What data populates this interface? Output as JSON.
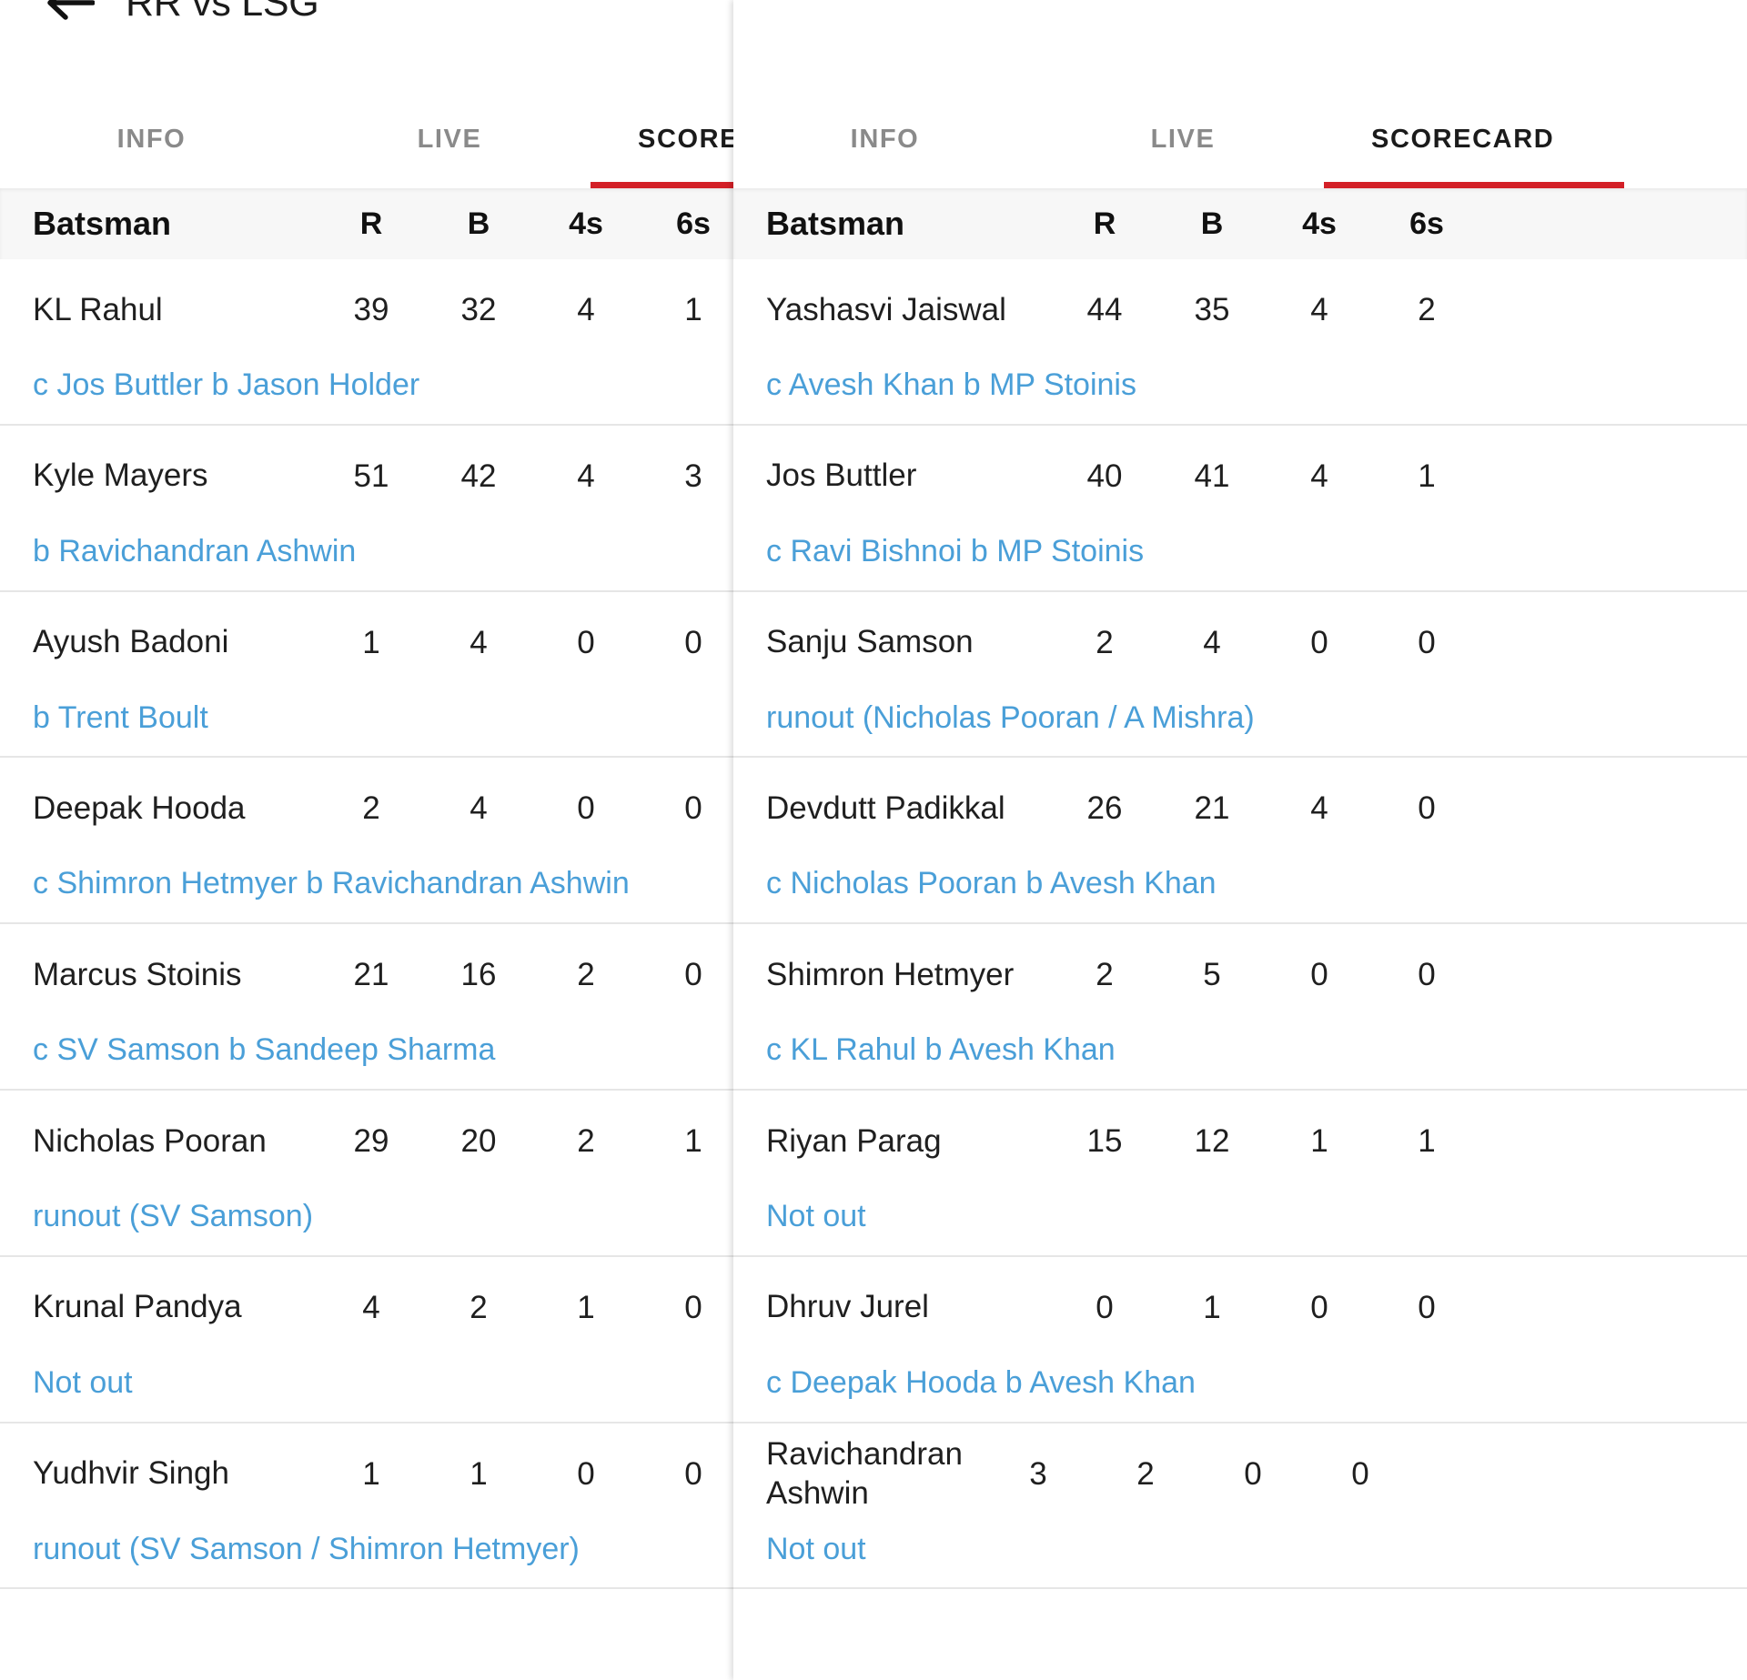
{
  "app": {
    "back_icon": "back-arrow-icon",
    "accent_red": "#d32027",
    "link_blue": "#4a9fd8"
  },
  "left_panel": {
    "title": "RR vs LSG",
    "tabs": [
      {
        "label": "INFO",
        "active": false
      },
      {
        "label": "LIVE",
        "active": false
      },
      {
        "label": "SCORECARD",
        "active": true
      }
    ],
    "table": {
      "headers": {
        "batsman": "Batsman",
        "runs": "R",
        "balls": "B",
        "fours": "4s",
        "sixes": "6s"
      },
      "rows": [
        {
          "name": "KL Rahul",
          "R": "39",
          "B": "32",
          "4s": "4",
          "6s": "1",
          "dismissal": "c Jos Buttler b Jason Holder"
        },
        {
          "name": "Kyle Mayers",
          "R": "51",
          "B": "42",
          "4s": "4",
          "6s": "3",
          "dismissal": "b Ravichandran Ashwin"
        },
        {
          "name": "Ayush Badoni",
          "R": "1",
          "B": "4",
          "4s": "0",
          "6s": "0",
          "dismissal": "b Trent Boult"
        },
        {
          "name": "Deepak Hooda",
          "R": "2",
          "B": "4",
          "4s": "0",
          "6s": "0",
          "dismissal": "c Shimron Hetmyer b Ravichandran Ashwin"
        },
        {
          "name": "Marcus Stoinis",
          "R": "21",
          "B": "16",
          "4s": "2",
          "6s": "0",
          "dismissal": "c SV Samson b Sandeep Sharma"
        },
        {
          "name": "Nicholas Pooran",
          "R": "29",
          "B": "20",
          "4s": "2",
          "6s": "1",
          "dismissal": "runout (SV Samson)"
        },
        {
          "name": "Krunal Pandya",
          "R": "4",
          "B": "2",
          "4s": "1",
          "6s": "0",
          "dismissal": "Not out"
        },
        {
          "name": "Yudhvir Singh",
          "R": "1",
          "B": "1",
          "4s": "0",
          "6s": "0",
          "dismissal": "runout (SV Samson / Shimron Hetmyer)"
        }
      ]
    }
  },
  "right_panel": {
    "tabs": [
      {
        "label": "INFO",
        "active": false
      },
      {
        "label": "LIVE",
        "active": false
      },
      {
        "label": "SCORECARD",
        "active": true
      }
    ],
    "table": {
      "headers": {
        "batsman": "Batsman",
        "runs": "R",
        "balls": "B",
        "fours": "4s",
        "sixes": "6s"
      },
      "rows": [
        {
          "name": "Yashasvi Jaiswal",
          "R": "44",
          "B": "35",
          "4s": "4",
          "6s": "2",
          "dismissal": "c Avesh Khan b MP Stoinis"
        },
        {
          "name": "Jos Buttler",
          "R": "40",
          "B": "41",
          "4s": "4",
          "6s": "1",
          "dismissal": "c Ravi Bishnoi b MP Stoinis"
        },
        {
          "name": "Sanju Samson",
          "R": "2",
          "B": "4",
          "4s": "0",
          "6s": "0",
          "dismissal": "runout (Nicholas Pooran / A Mishra)"
        },
        {
          "name": "Devdutt Padikkal",
          "R": "26",
          "B": "21",
          "4s": "4",
          "6s": "0",
          "dismissal": "c Nicholas Pooran b Avesh Khan"
        },
        {
          "name": "Shimron Hetmyer",
          "R": "2",
          "B": "5",
          "4s": "0",
          "6s": "0",
          "dismissal": "c KL Rahul b Avesh Khan"
        },
        {
          "name": "Riyan Parag",
          "R": "15",
          "B": "12",
          "4s": "1",
          "6s": "1",
          "dismissal": "Not out"
        },
        {
          "name": "Dhruv Jurel",
          "R": "0",
          "B": "1",
          "4s": "0",
          "6s": "0",
          "dismissal": "c Deepak Hooda b Avesh Khan"
        },
        {
          "name": "Ravichandran Ashwin",
          "R": "3",
          "B": "2",
          "4s": "0",
          "6s": "0",
          "dismissal": "Not out"
        }
      ]
    }
  }
}
